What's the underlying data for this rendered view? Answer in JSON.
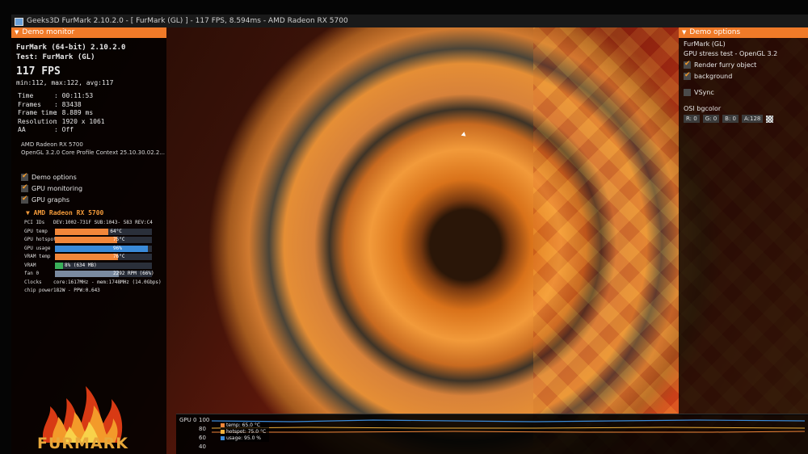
{
  "window": {
    "title": "Geeks3D FurMark 2.10.2.0 - [ FurMark (GL) ] - 117 FPS, 8.594ms - AMD Radeon RX 5700"
  },
  "demo_monitor": {
    "header": "Demo monitor",
    "app_title": "FurMark (64-bit) 2.10.2.0",
    "test_title": "Test: FurMark (GL)",
    "fps": "117 FPS",
    "fps_stats": "min:112, max:122, avg:117",
    "stats": [
      {
        "key": "Time",
        "value": ": 00:11:53"
      },
      {
        "key": "Frames",
        "value": ": 83438"
      },
      {
        "key": "Frame time",
        "value": ": 8.889 ms"
      },
      {
        "key": "Resolution",
        "value": ": 1920 x 1061"
      },
      {
        "key": "AA",
        "value": ": Off"
      }
    ],
    "gpu_name": "AMD Radeon RX 5700",
    "gl_info": "OpenGL 3.2.0 Core Profile Context 25.10.30.02.2...",
    "checkboxes": [
      {
        "label": "Demo options",
        "checked": true
      },
      {
        "label": "GPU monitoring",
        "checked": true
      },
      {
        "label": "GPU graphs",
        "checked": true
      }
    ],
    "gpu_section": {
      "title": "AMD Radeon RX 5700",
      "pci": {
        "key": "PCI IDs",
        "value": "DEV:1002-731F SUB:1043- 583 REV:C4"
      },
      "bars": [
        {
          "key": "GPU temp",
          "text": "64°C",
          "level": 0.55,
          "color": "#f2873a"
        },
        {
          "key": "GPU hotspot",
          "text": "75°C",
          "level": 0.64,
          "color": "#f2873a"
        },
        {
          "key": "GPU usage",
          "text": "96%",
          "level": 0.96,
          "color": "#3a8ad8"
        },
        {
          "key": "VRAM temp",
          "text": "76°C",
          "level": 0.65,
          "color": "#f2873a"
        },
        {
          "key": "VRAM",
          "text": "8% (634 MB)",
          "level": 0.08,
          "color": "#3ab05a"
        },
        {
          "key": "fan 0",
          "text": "2292 RPM (66%)",
          "level": 0.66,
          "color": "#7a8aa0"
        }
      ],
      "clocks": {
        "key": "Clocks",
        "value": "core:1617MHz - mem:1748MHz (14.0Gbps)"
      },
      "chip_power": {
        "key": "chip power",
        "value": "182W - PPW:0.643"
      }
    }
  },
  "logo": {
    "text": "FURMARK"
  },
  "demo_options": {
    "header": "Demo options",
    "test_name": "FurMark (GL)",
    "test_desc": "GPU stress test - OpenGL 3.2",
    "render_furry": {
      "label": "Render furry object",
      "checked": true
    },
    "background": {
      "label": "background",
      "checked": true
    },
    "vsync": {
      "label": "VSync",
      "checked": false
    },
    "bgcolor_label": "OSI bgcolor",
    "bgcolor": {
      "r": "R: 0",
      "g": "G: 0",
      "b": "B: 0",
      "a": "A:128"
    }
  },
  "gpu_graph": {
    "label": "GPU 0",
    "ticks": [
      "100",
      "80",
      "60",
      "40"
    ],
    "legend": [
      {
        "text": "temp: 65.0 °C",
        "color": "#f2873a"
      },
      {
        "text": "hotspot: 75.0 °C",
        "color": "#f2b23a"
      },
      {
        "text": "usage: 95.0 %",
        "color": "#3a8ad8"
      }
    ]
  }
}
